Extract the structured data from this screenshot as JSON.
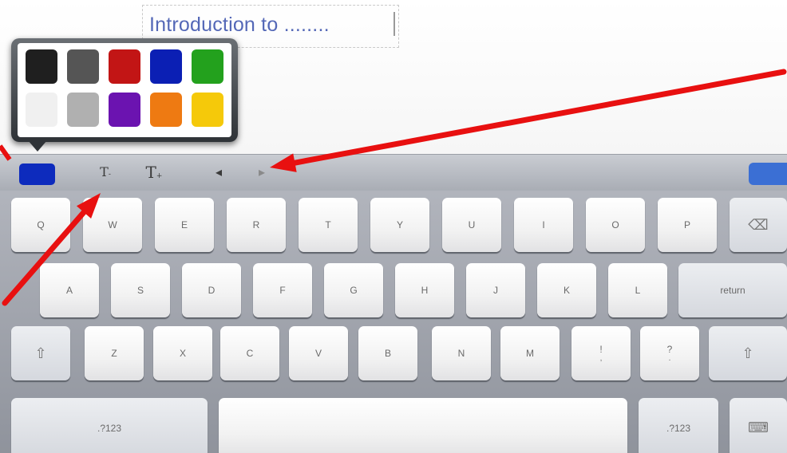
{
  "document": {
    "text": "Introduction to ........"
  },
  "color_picker": {
    "swatches": [
      {
        "name": "black",
        "color": "#1f1f1f"
      },
      {
        "name": "dark-gray",
        "color": "#555555"
      },
      {
        "name": "red",
        "color": "#c21515"
      },
      {
        "name": "blue",
        "color": "#0b1fb4"
      },
      {
        "name": "green",
        "color": "#23a11d"
      },
      {
        "name": "white",
        "color": "#f0f0f0"
      },
      {
        "name": "light-gray",
        "color": "#b0b0b0"
      },
      {
        "name": "purple",
        "color": "#6b13b0"
      },
      {
        "name": "orange",
        "color": "#ee7a12"
      },
      {
        "name": "yellow",
        "color": "#f5c90a"
      }
    ],
    "selected_color": "#0d2bbd"
  },
  "toolbar": {
    "font_smaller": "T",
    "font_larger": "T",
    "prev_arrow": "◂",
    "next_arrow": "▸",
    "hide_button_color": "#3b6fd4"
  },
  "keyboard": {
    "rows": [
      [
        "Q",
        "W",
        "E",
        "R",
        "T",
        "Y",
        "U",
        "I",
        "O",
        "P"
      ],
      [
        "A",
        "S",
        "D",
        "F",
        "G",
        "H",
        "J",
        "K",
        "L"
      ],
      [
        "Z",
        "X",
        "C",
        "V",
        "B",
        "N",
        "M",
        "!",
        "?"
      ]
    ],
    "punct_sub": [
      ",",
      "."
    ],
    "return_label": "return",
    "numbers_label": ".?123",
    "shift_symbol": "⇧",
    "backspace_symbol": "⌫",
    "dismiss_symbol": "⌨"
  },
  "annotation_color": "#e81010"
}
